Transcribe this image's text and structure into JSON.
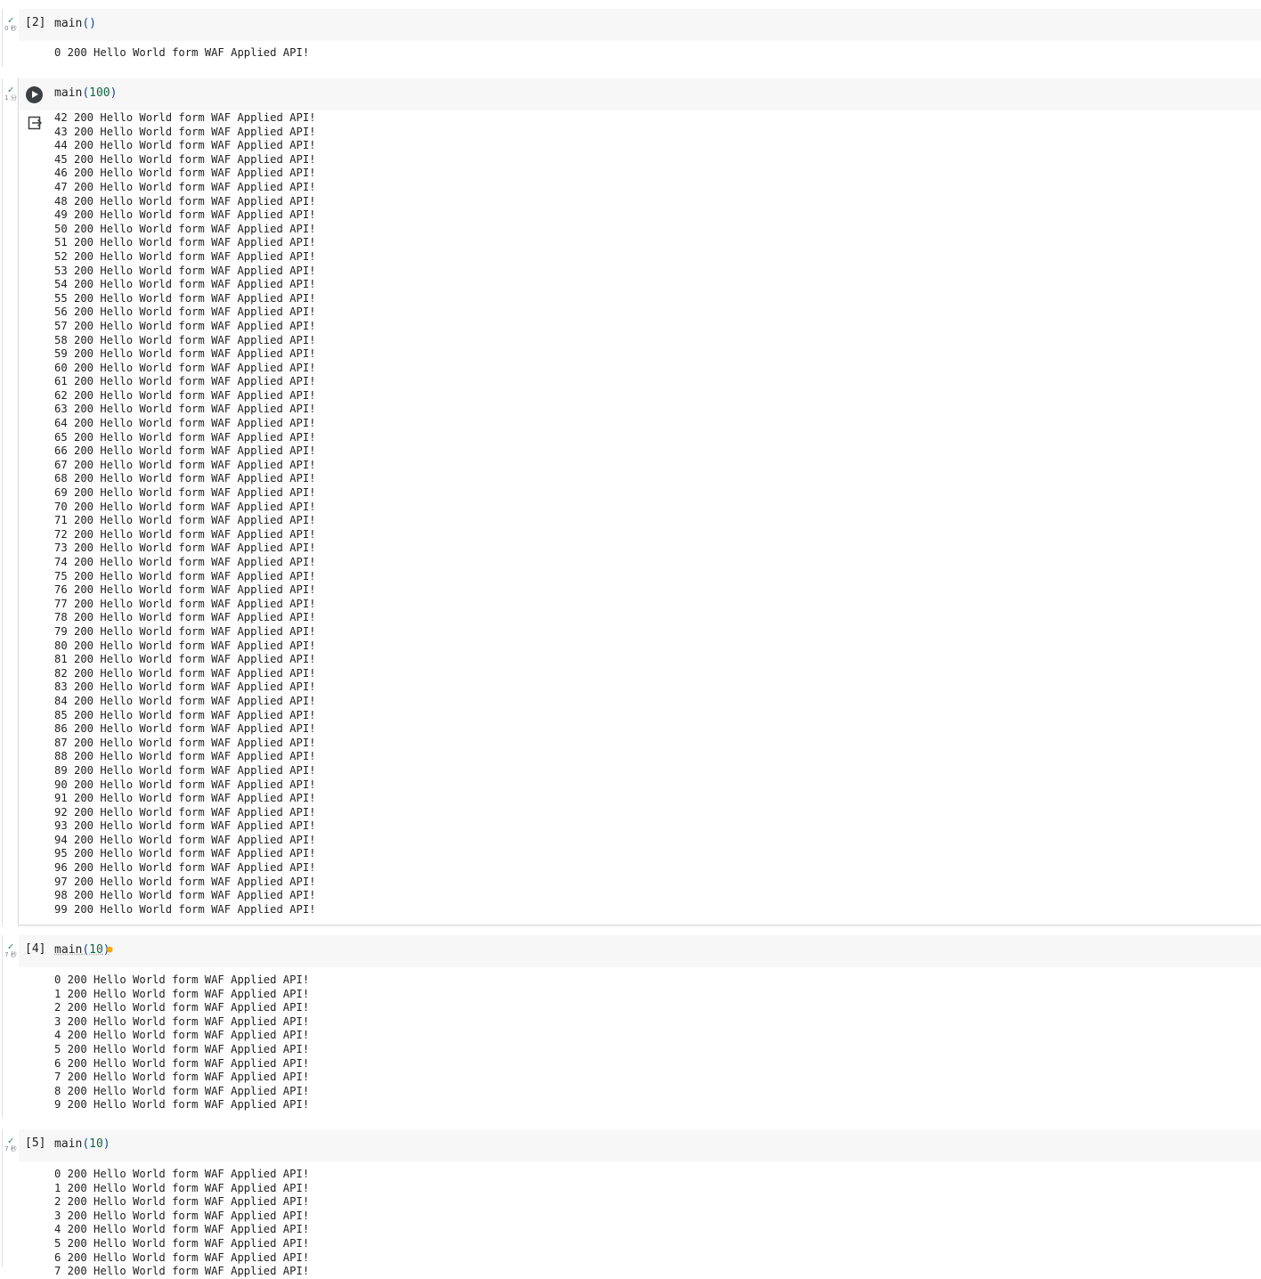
{
  "cells": [
    {
      "id": "cell-2",
      "exec_count": "[2]",
      "code_fn": "main",
      "code_open": "(",
      "code_arg": "",
      "code_close": ")",
      "status_icon": "check-icon",
      "duration": "0 秒",
      "output": "0 200 Hello World form WAF Applied API!"
    },
    {
      "id": "cell-3",
      "exec_count": "",
      "code_fn": "main",
      "code_open": "(",
      "code_arg": "100",
      "code_close": ")",
      "status_icon": "check-icon",
      "duration": "1 分",
      "output": "42 200 Hello World form WAF Applied API!\n43 200 Hello World form WAF Applied API!\n44 200 Hello World form WAF Applied API!\n45 200 Hello World form WAF Applied API!\n46 200 Hello World form WAF Applied API!\n47 200 Hello World form WAF Applied API!\n48 200 Hello World form WAF Applied API!\n49 200 Hello World form WAF Applied API!\n50 200 Hello World form WAF Applied API!\n51 200 Hello World form WAF Applied API!\n52 200 Hello World form WAF Applied API!\n53 200 Hello World form WAF Applied API!\n54 200 Hello World form WAF Applied API!\n55 200 Hello World form WAF Applied API!\n56 200 Hello World form WAF Applied API!\n57 200 Hello World form WAF Applied API!\n58 200 Hello World form WAF Applied API!\n59 200 Hello World form WAF Applied API!\n60 200 Hello World form WAF Applied API!\n61 200 Hello World form WAF Applied API!\n62 200 Hello World form WAF Applied API!\n63 200 Hello World form WAF Applied API!\n64 200 Hello World form WAF Applied API!\n65 200 Hello World form WAF Applied API!\n66 200 Hello World form WAF Applied API!\n67 200 Hello World form WAF Applied API!\n68 200 Hello World form WAF Applied API!\n69 200 Hello World form WAF Applied API!\n70 200 Hello World form WAF Applied API!\n71 200 Hello World form WAF Applied API!\n72 200 Hello World form WAF Applied API!\n73 200 Hello World form WAF Applied API!\n74 200 Hello World form WAF Applied API!\n75 200 Hello World form WAF Applied API!\n76 200 Hello World form WAF Applied API!\n77 200 Hello World form WAF Applied API!\n78 200 Hello World form WAF Applied API!\n79 200 Hello World form WAF Applied API!\n80 200 Hello World form WAF Applied API!\n81 200 Hello World form WAF Applied API!\n82 200 Hello World form WAF Applied API!\n83 200 Hello World form WAF Applied API!\n84 200 Hello World form WAF Applied API!\n85 200 Hello World form WAF Applied API!\n86 200 Hello World form WAF Applied API!\n87 200 Hello World form WAF Applied API!\n88 200 Hello World form WAF Applied API!\n89 200 Hello World form WAF Applied API!\n90 200 Hello World form WAF Applied API!\n91 200 Hello World form WAF Applied API!\n92 200 Hello World form WAF Applied API!\n93 200 Hello World form WAF Applied API!\n94 200 Hello World form WAF Applied API!\n95 200 Hello World form WAF Applied API!\n96 200 Hello World form WAF Applied API!\n97 200 Hello World form WAF Applied API!\n98 200 Hello World form WAF Applied API!\n99 200 Hello World form WAF Applied API!"
    },
    {
      "id": "cell-4",
      "exec_count": "[4]",
      "code_fn": "main",
      "code_open": "(",
      "code_arg": "10",
      "code_close": ")",
      "status_icon": "check-icon",
      "duration": "7 秒",
      "output": "0 200 Hello World form WAF Applied API!\n1 200 Hello World form WAF Applied API!\n2 200 Hello World form WAF Applied API!\n3 200 Hello World form WAF Applied API!\n4 200 Hello World form WAF Applied API!\n5 200 Hello World form WAF Applied API!\n6 200 Hello World form WAF Applied API!\n7 200 Hello World form WAF Applied API!\n8 200 Hello World form WAF Applied API!\n9 200 Hello World form WAF Applied API!"
    },
    {
      "id": "cell-5",
      "exec_count": "[5]",
      "code_fn": "main",
      "code_open": "(",
      "code_arg": "10",
      "code_close": ")",
      "status_icon": "check-icon",
      "duration": "7 秒",
      "output": "0 200 Hello World form WAF Applied API!\n1 200 Hello World form WAF Applied API!\n2 200 Hello World form WAF Applied API!\n3 200 Hello World form WAF Applied API!\n4 200 Hello World form WAF Applied API!\n5 200 Hello World form WAF Applied API!\n6 200 Hello World form WAF Applied API!\n7 200 Hello World form WAF Applied API!"
    }
  ],
  "icons": {
    "run": "play-circle-icon",
    "output_action": "output-exit-icon",
    "suggestion": "lightbulb-icon"
  },
  "colors": {
    "check": "#1e8e3e",
    "code_bg": "#f7f7f7",
    "number": "#116644",
    "paren": "#0d47a1",
    "bulb": "#f9ab00"
  }
}
